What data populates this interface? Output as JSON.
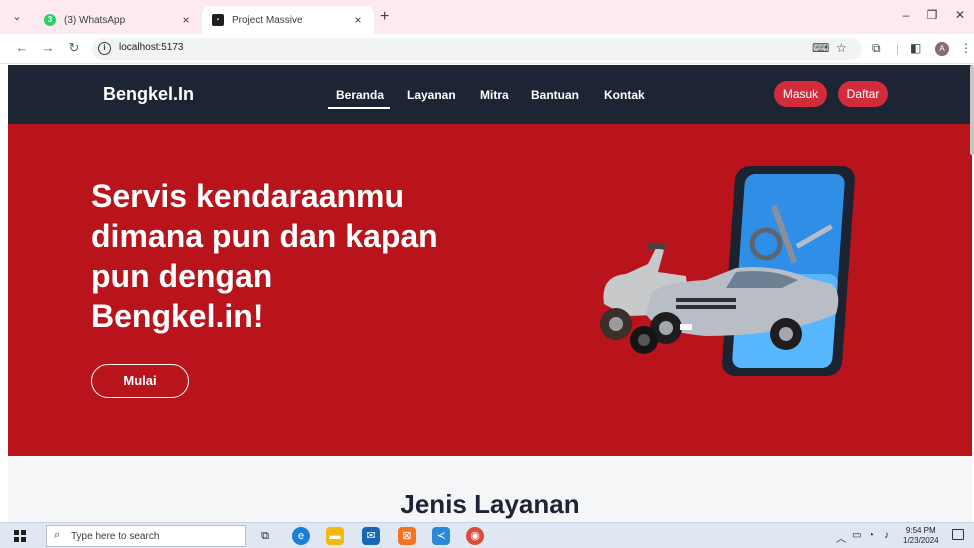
{
  "browser": {
    "tabs": [
      {
        "title": "(3) WhatsApp",
        "badge": "3",
        "active": false
      },
      {
        "title": "Project Massive",
        "active": true
      }
    ],
    "url": "localhost:5173",
    "avatar_letter": "A"
  },
  "site": {
    "brand": "Bengkel.In",
    "menu": [
      "Beranda",
      "Layanan",
      "Mitra",
      "Bantuan",
      "Kontak"
    ],
    "login_label": "Masuk",
    "register_label": "Daftar"
  },
  "hero": {
    "title_lines": [
      "Servis kendaraanmu",
      "dimana pun dan kapan",
      "pun dengan",
      "Bengkel.in!"
    ],
    "cta_label": "Mulai"
  },
  "section": {
    "title": "Jenis Layanan"
  },
  "taskbar": {
    "search_placeholder": "Type here to search",
    "time": "9:54 PM",
    "date": "1/23/2024"
  },
  "colors": {
    "navbar": "#1d2433",
    "hero": "#b9131b",
    "button": "#d22b3a"
  }
}
